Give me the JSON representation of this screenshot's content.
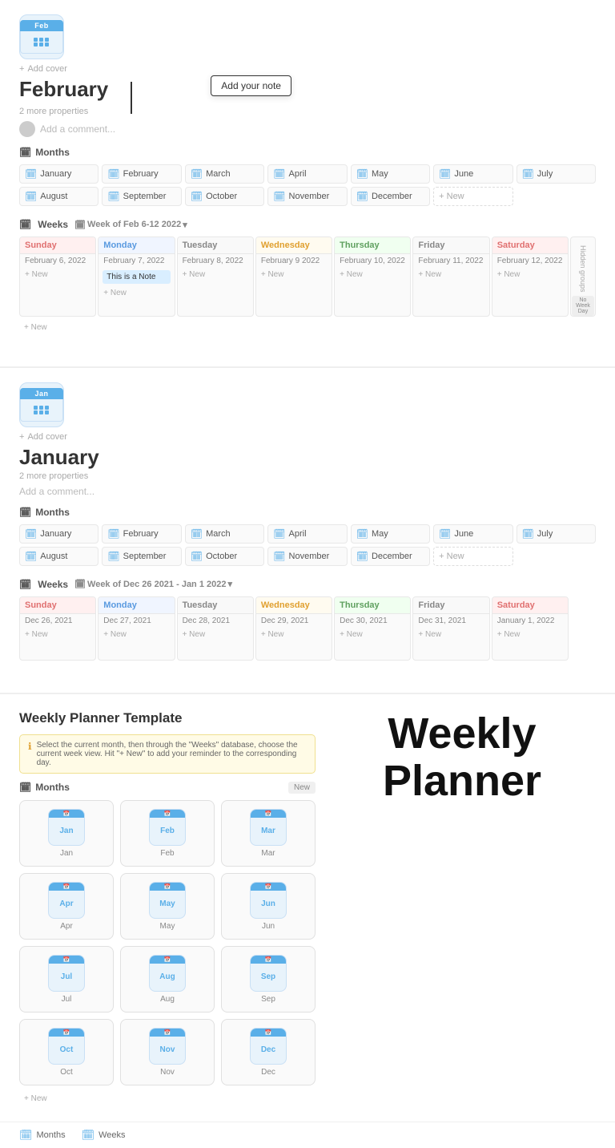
{
  "february": {
    "icon_month": "Feb",
    "title": "February",
    "add_cover": "Add cover",
    "properties": "2 more properties",
    "comment_placeholder": "Add a comment...",
    "tooltip": "Add your note",
    "months_label": "Months",
    "months": [
      {
        "name": "January"
      },
      {
        "name": "February"
      },
      {
        "name": "March"
      },
      {
        "name": "April"
      },
      {
        "name": "May"
      },
      {
        "name": "June"
      },
      {
        "name": "July"
      },
      {
        "name": "August"
      },
      {
        "name": "September"
      },
      {
        "name": "October"
      },
      {
        "name": "November"
      },
      {
        "name": "December"
      }
    ],
    "weeks_label": "Weeks",
    "week_range": "Week of Feb 6-12 2022",
    "days": [
      {
        "name": "Sunday",
        "class": "sunday",
        "date": "February 6, 2022",
        "note": ""
      },
      {
        "name": "Monday",
        "class": "monday",
        "date": "February 7, 2022",
        "note": "This is a Note"
      },
      {
        "name": "Tuesday",
        "class": "tuesday",
        "date": "February 8, 2022",
        "note": ""
      },
      {
        "name": "Wednesday",
        "class": "wednesday",
        "date": "February 9 2022",
        "note": ""
      },
      {
        "name": "Thursday",
        "class": "thursday",
        "date": "February 10, 2022",
        "note": ""
      },
      {
        "name": "Friday",
        "class": "friday",
        "date": "February 11, 2022",
        "note": ""
      },
      {
        "name": "Saturday",
        "class": "saturday",
        "date": "February 12, 2022",
        "note": ""
      }
    ],
    "hidden_groups": "Hidden groups",
    "no_week_day": "No Week Day"
  },
  "january": {
    "icon_month": "Jan",
    "title": "January",
    "add_cover": "Add cover",
    "properties": "2 more properties",
    "comment_placeholder": "Add a comment...",
    "months_label": "Months",
    "months": [
      {
        "name": "January"
      },
      {
        "name": "February"
      },
      {
        "name": "March"
      },
      {
        "name": "April"
      },
      {
        "name": "May"
      },
      {
        "name": "June"
      },
      {
        "name": "July"
      },
      {
        "name": "August"
      },
      {
        "name": "September"
      },
      {
        "name": "October"
      },
      {
        "name": "November"
      },
      {
        "name": "December"
      }
    ],
    "weeks_label": "Weeks",
    "week_range": "Week of Dec 26 2021 - Jan 1 2022",
    "days": [
      {
        "name": "Sunday",
        "class": "sunday",
        "date": "Dec 26, 2021"
      },
      {
        "name": "Monday",
        "class": "monday",
        "date": "Dec 27, 2021"
      },
      {
        "name": "Tuesday",
        "class": "tuesday",
        "date": "Dec 28, 2021"
      },
      {
        "name": "Wednesday",
        "class": "wednesday",
        "date": "Dec 29, 2021"
      },
      {
        "name": "Thursday",
        "class": "thursday",
        "date": "Dec 30, 2021"
      },
      {
        "name": "Friday",
        "class": "friday",
        "date": "Dec 31, 2021"
      },
      {
        "name": "Saturday",
        "class": "saturday",
        "date": "January 1, 2022"
      }
    ]
  },
  "template": {
    "title": "Weekly Planner Template",
    "info_text": "Select the current month, then through the \"Weeks\" database, choose the current week view. Hit \"+ New\" to add your reminder to the corresponding day.",
    "months_label": "Months",
    "new_btn": "New",
    "month_cards": [
      {
        "abbr": "Jan",
        "name": "January"
      },
      {
        "abbr": "Feb",
        "name": "February"
      },
      {
        "abbr": "Mar",
        "name": "March"
      },
      {
        "abbr": "Apr",
        "name": "April"
      },
      {
        "abbr": "May",
        "name": "May"
      },
      {
        "abbr": "Jun",
        "name": "June"
      },
      {
        "abbr": "Jul",
        "name": "July"
      },
      {
        "abbr": "Aug",
        "name": "August"
      },
      {
        "abbr": "Sep",
        "name": "September"
      },
      {
        "abbr": "Oct",
        "name": "October"
      },
      {
        "abbr": "Nov",
        "name": "November"
      },
      {
        "abbr": "Dec",
        "name": "December"
      }
    ],
    "big_title_line1": "Weekly",
    "big_title_line2": "Planner",
    "footer_tabs": [
      {
        "label": "Months",
        "icon": "📅"
      },
      {
        "label": "Weeks",
        "icon": "📅"
      }
    ]
  },
  "new_label": "+ New",
  "add_new": "+ New"
}
